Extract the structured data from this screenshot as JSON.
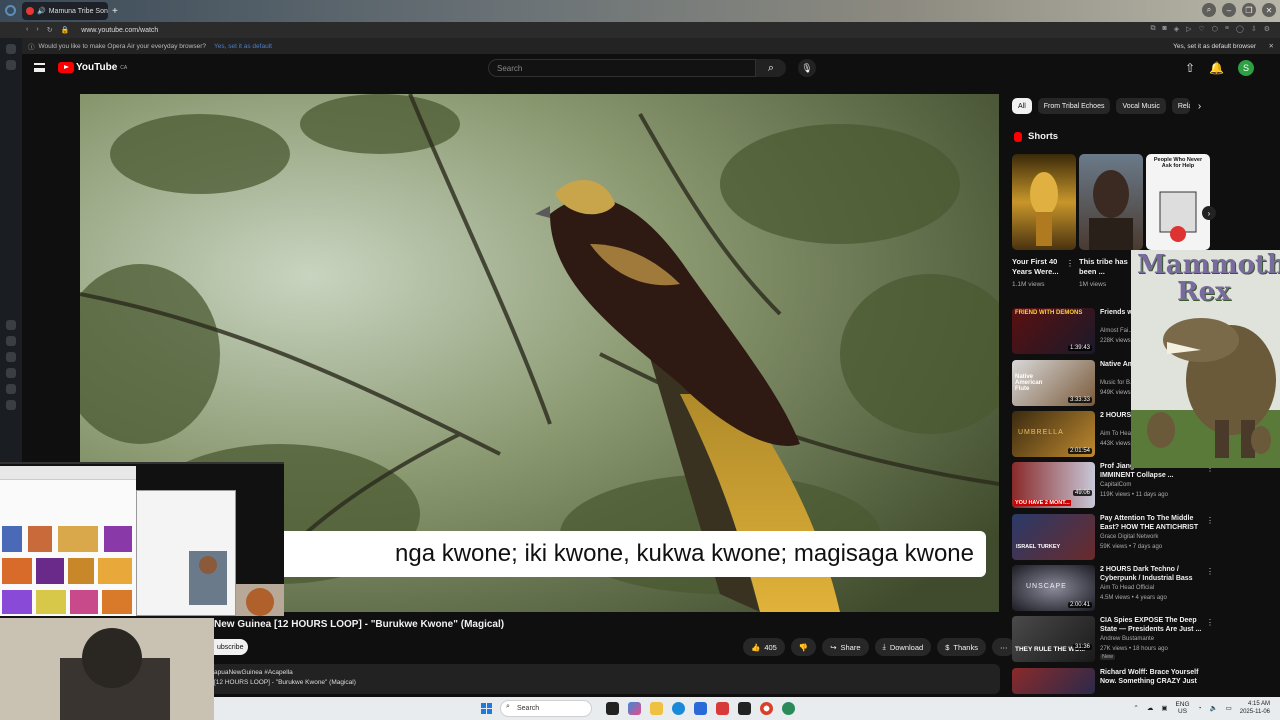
{
  "browser": {
    "tab_title": "Mamuna Tribe Son",
    "new_tab": "+",
    "url": "www.youtube.com/watch",
    "infobar_text": "Would you like to make Opera Air your everyday browser?",
    "infobar_link": "Yes, set it as default",
    "infobar_right": "Yes, set it as default browser"
  },
  "youtube": {
    "logo_text": "YouTube",
    "logo_region": "CA",
    "search_placeholder": "Search",
    "avatar_letter": "S"
  },
  "video": {
    "caption": "nga kwone; iki kwone, kukwa kwone; magisaga kwone",
    "title": "New Guinea [12 HOURS LOOP] - \"Burukwe Kwone\" (Magical)",
    "subscribe_label": "ubscribe",
    "likes": "405",
    "share_label": "Share",
    "download_label": "Download",
    "thanks_label": "Thanks",
    "desc_line1": "apuaNewGuinea #Acapella",
    "desc_line2": "[12 HOURS LOOP] - \"Burukwe Kwone\" (Magical)"
  },
  "chips": [
    "All",
    "From Tribal Echoes",
    "Vocal Music",
    "Rela"
  ],
  "shorts": {
    "heading": "Shorts",
    "items": [
      {
        "title": "Your First 40 Years Were...",
        "views": "1.1M views"
      },
      {
        "title": "This tribe has been ...",
        "views": "1M views"
      },
      {
        "thumb_text": "People Who Never Ask for Help"
      }
    ]
  },
  "recommendations": [
    {
      "title": "Friends wi... Atheist Wi...",
      "channel": "Almost Fai...",
      "meta": "228K views",
      "duration": "1:39:43",
      "thumb_text": "FRIEND WITH DEMONS"
    },
    {
      "title": "Native Am... Remove A...",
      "channel": "Music for B...",
      "meta": "949K views",
      "duration": "3:33:33",
      "thumb_text": "Native American Flute"
    },
    {
      "title": "2 HOURS ... / Industri...",
      "channel": "Aim To Hea...",
      "meta": "443K views",
      "duration": "2:01:54",
      "thumb_text": "UMBRELLA"
    },
    {
      "title": "Prof Jiang: ... Wars & 1 IMMINENT Collapse ...",
      "channel": "CapitalCom",
      "meta": "119K views • 11 days ago",
      "duration": "49:06",
      "thumb_text": "YOU HAVE 2 MONT..."
    },
    {
      "title": "Pay Attention To The Middle East? HOW THE ANTICHRIST ...",
      "channel": "Grace Digital Network",
      "meta": "59K views • 7 days ago",
      "duration": "",
      "thumb_text": "ISRAEL TURKEY"
    },
    {
      "title": "2 HOURS Dark Techno / Cyberpunk / Industrial Bass Mi...",
      "channel": "Aim To Head Official",
      "meta": "4.5M views • 4 years ago",
      "duration": "2:00:41",
      "thumb_text": "UNSCAPE"
    },
    {
      "title": "CIA Spies EXPOSE The Deep State — Presidents Are Just ...",
      "channel": "Andrew Bustamante",
      "meta": "27K views • 18 hours ago",
      "duration": "31:36",
      "thumb_text": "THEY RULE THE WO...",
      "badge": "New"
    },
    {
      "title": "Richard Wolff: Brace Yourself Now. Something CRAZY Just ...",
      "channel": "",
      "meta": "",
      "duration": "",
      "thumb_text": ""
    }
  ],
  "overlay": {
    "mammoth_line1": "Mammoth",
    "mammoth_line2": "Rex"
  },
  "taskbar": {
    "search_label": "Search",
    "lang_top": "ENG",
    "lang_bottom": "US",
    "time": "4:15 AM",
    "date": "2025-11-06"
  },
  "colors": {
    "yt_red": "#ff0000",
    "accent_link": "#4a7fc7",
    "avatar": "#2ea043"
  }
}
